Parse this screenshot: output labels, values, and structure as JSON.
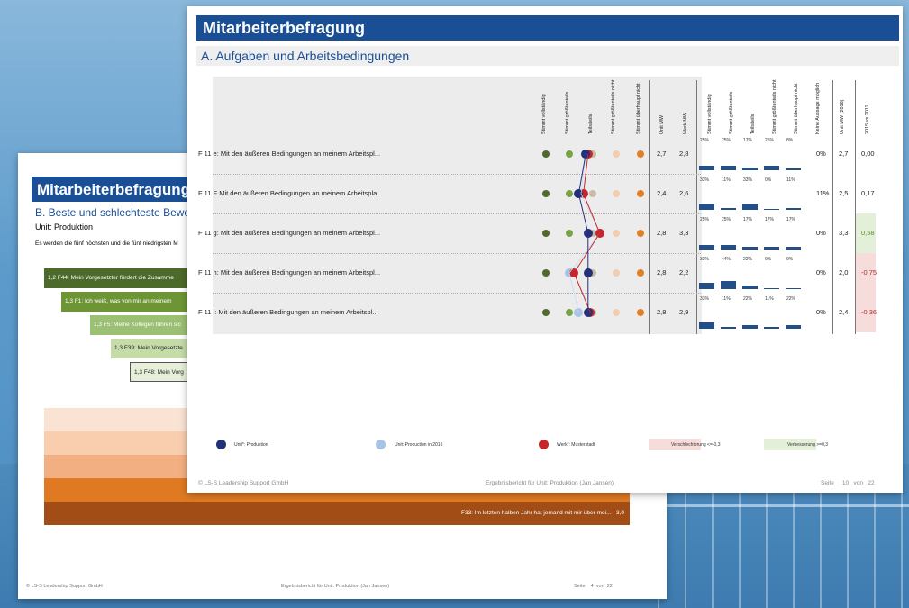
{
  "back": {
    "title": "Mitarbeiterbefragung",
    "subtitle": "B. Beste und schlechteste Bewertur",
    "unit": "Unit: Produktion",
    "intro": "Es werden die fünf höchsten und die fünf niedrigsten M",
    "stairs": [
      "1,2  F44: Mein Vorgesetzter fördert die Zusamme",
      "1,3  F1: Ich weiß, was von mir an meinem",
      "1,3  F5: Meine Kollegen führen sic",
      "1,3  F39: Mein Vorgesetzte",
      "1,3  F48: Mein Vorg"
    ],
    "bottom_band_text": "F33: Im letzten halben Jahr hat jemand mit mir über mei...",
    "bottom_band_value": "3,0",
    "footer": {
      "company": "© LS-S Leadership Support GmbH",
      "report": "Ergebnisbericht für Unit: Produktion (Jan Jansen)",
      "page_label": "Seite",
      "page": "4",
      "of": "von",
      "total": "22"
    }
  },
  "front": {
    "title": "Mitarbeiterbefragung",
    "subtitle": "A. Aufgaben und Arbeitsbedingungen",
    "scale_headers": [
      "Stimmt vollständig",
      "Stimmt größtenteils",
      "Teils/teils",
      "Stimmt größtenteils nicht",
      "Stimmt überhaupt nicht"
    ],
    "mw_headers": [
      "Unit MW",
      "Werk MW"
    ],
    "dist_headers": [
      "Stimmt vollständig",
      "Stimmt größtenteils",
      "Teils/teils",
      "Stimmt größtenteils nicht",
      "Stimmt überhaupt nicht",
      "Keine Aussage möglich"
    ],
    "trend_headers": [
      "Unit MW (2016)",
      "2015 vs 2011"
    ],
    "rows": [
      {
        "label": "F 11 e: Mit den äußeren Bedingungen an meinem Arbeitspl...",
        "unit_mw": "2,7",
        "werk_mw": "2,8",
        "unit_val": 2.7,
        "werk_val": 2.8,
        "prev_val": 2.7,
        "pcts": [
          "25%",
          "25%",
          "17%",
          "25%",
          "8%"
        ],
        "shares": [
          0.25,
          0.25,
          0.17,
          0.25,
          0.08
        ],
        "keine": "0%",
        "mw2016": "2,7",
        "diff": "0,00",
        "trend": "neutral"
      },
      {
        "label": "F 11 F Mit den äußeren Bedingungen an meinem Arbeitspla...",
        "unit_mw": "2,4",
        "werk_mw": "2,6",
        "unit_val": 2.4,
        "werk_val": 2.6,
        "prev_val": 2.5,
        "pcts": [
          "33%",
          "11%",
          "33%",
          "0%",
          "11%"
        ],
        "shares": [
          0.33,
          0.11,
          0.33,
          0,
          0.11
        ],
        "keine": "11%",
        "mw2016": "2,5",
        "diff": "0,17",
        "trend": "neutral"
      },
      {
        "label": "F 11 g: Mit den äußeren Bedingungen an meinem Arbeitspl...",
        "unit_mw": "2,8",
        "werk_mw": "3,3",
        "unit_val": 2.8,
        "werk_val": 3.3,
        "prev_val": 3.3,
        "pcts": [
          "25%",
          "25%",
          "17%",
          "17%",
          "17%"
        ],
        "shares": [
          0.25,
          0.25,
          0.17,
          0.17,
          0.17
        ],
        "keine": "0%",
        "mw2016": "3,3",
        "diff": "0,58",
        "trend": "better"
      },
      {
        "label": "F 11 h: Mit den äußeren Bedingungen an meinem Arbeitspl...",
        "unit_mw": "2,8",
        "werk_mw": "2,2",
        "unit_val": 2.8,
        "werk_val": 2.2,
        "prev_val": 2.0,
        "pcts": [
          "33%",
          "44%",
          "22%",
          "0%",
          "0%"
        ],
        "shares": [
          0.33,
          0.44,
          0.22,
          0,
          0
        ],
        "keine": "0%",
        "mw2016": "2,0",
        "diff": "-0,75",
        "trend": "worse"
      },
      {
        "label": "F 11 i: Mit den äußeren Bedingungen an meinem Arbeitspl...",
        "unit_mw": "2,8",
        "werk_mw": "2,9",
        "unit_val": 2.8,
        "werk_val": 2.9,
        "prev_val": 2.4,
        "pcts": [
          "33%",
          "11%",
          "22%",
          "11%",
          "22%"
        ],
        "shares": [
          0.33,
          0.11,
          0.22,
          0.11,
          0.22
        ],
        "keine": "0%",
        "mw2016": "2,4",
        "diff": "-0,36",
        "trend": "worse"
      }
    ],
    "legend": {
      "unit": "Unit*: Produktion",
      "prev": "Unit: Production in 2016",
      "werk": "Werk*: Musterstadt",
      "worse": "Verschlechterung <=-0,3",
      "better": "Verbesserung >=0,3"
    },
    "colors": {
      "unit": "#23307a",
      "prev": "#a9c3e6",
      "werk": "#c4262b",
      "scale": [
        "#4f6b2a",
        "#7aa348",
        "#c9bba6",
        "#f3cdb0",
        "#e37f25"
      ],
      "worse_bg": "#f7dcdc",
      "better_bg": "#e4efd9",
      "bar": "#234f86"
    },
    "footer": {
      "company": "© LS-S Leadership Support GmbH",
      "report": "Ergebnisbericht für Unit: Produktion (Jan Jansen)",
      "page_label": "Seite",
      "page": "10",
      "of": "von",
      "total": "22"
    }
  }
}
